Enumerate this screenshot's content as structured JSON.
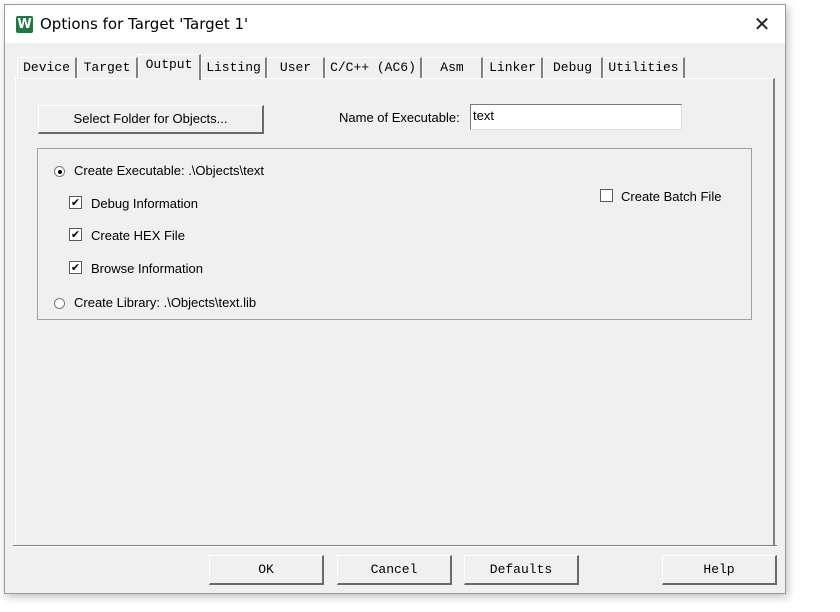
{
  "window": {
    "title": "Options for Target 'Target 1'",
    "icon": "keil-uvision-icon",
    "close_glyph": "✕"
  },
  "tabs": [
    {
      "label": "Device"
    },
    {
      "label": "Target"
    },
    {
      "label": "Output",
      "active": true
    },
    {
      "label": "Listing"
    },
    {
      "label": "User"
    },
    {
      "label": "C/C++ (AC6)"
    },
    {
      "label": "Asm"
    },
    {
      "label": "Linker"
    },
    {
      "label": "Debug"
    },
    {
      "label": "Utilities"
    }
  ],
  "output": {
    "select_folder_label": "Select Folder for Objects...",
    "name_label": "Name of Executable:",
    "name_value": "text",
    "create_executable_label": "Create Executable:  .\\Objects\\text",
    "create_executable_selected": true,
    "debug_info_label": "Debug Information",
    "debug_info_checked": true,
    "hex_label": "Create HEX File",
    "hex_checked": true,
    "browse_label": "Browse Information",
    "browse_checked": true,
    "create_library_label": "Create Library:  .\\Objects\\text.lib",
    "create_library_selected": false,
    "batch_label": "Create Batch File",
    "batch_checked": false
  },
  "buttons": {
    "ok": "OK",
    "cancel": "Cancel",
    "defaults": "Defaults",
    "help": "Help"
  },
  "check_glyph": "✔"
}
